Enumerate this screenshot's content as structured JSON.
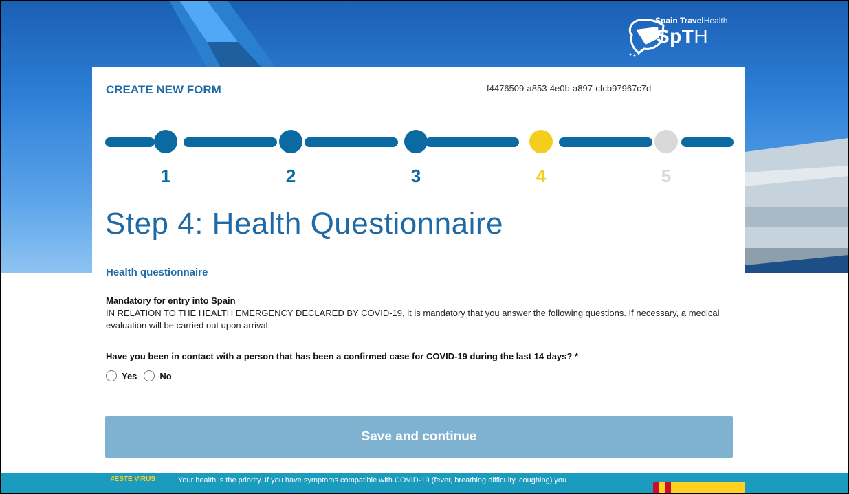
{
  "brand": {
    "top_bold": "Spain Travel",
    "top_light": "Health",
    "main_bold": "SpT",
    "main_light": "H"
  },
  "header": {
    "title": "CREATE NEW FORM",
    "form_id": "f4476509-a853-4e0b-a897-cfcb97967c7d"
  },
  "stepper": {
    "current_step": 4,
    "steps": [
      {
        "number": "1",
        "status": "completed"
      },
      {
        "number": "2",
        "status": "completed"
      },
      {
        "number": "3",
        "status": "completed"
      },
      {
        "number": "4",
        "status": "current"
      },
      {
        "number": "5",
        "status": "pending"
      }
    ]
  },
  "page": {
    "title": "Step 4: Health Questionnaire",
    "section_title": "Health questionnaire",
    "mandatory_title": "Mandatory for entry into Spain",
    "mandatory_text": "IN RELATION TO THE HEALTH EMERGENCY DECLARED BY COVID-19, it is mandatory that you answer the following questions. If necessary, a medical evaluation will be carried out upon arrival.",
    "question": "Have you been in contact with a person that has been a confirmed case for COVID-19 during the last 14 days? *",
    "options": [
      {
        "label": "Yes"
      },
      {
        "label": "No"
      }
    ],
    "save_label": "Save and continue"
  },
  "footer": {
    "badge": "#ESTE VIRUS",
    "text": "Your health is the priority. If you have symptoms compatible with COVID-19 (fever, breathing difficulty, coughing) you"
  },
  "colors": {
    "primary": "#1f6aa5",
    "step_done": "#0b6aa2",
    "step_current": "#f5cd1f",
    "step_pending": "#d9d9d9",
    "button": "#7fb2d1",
    "footer": "#1b9bbd"
  }
}
